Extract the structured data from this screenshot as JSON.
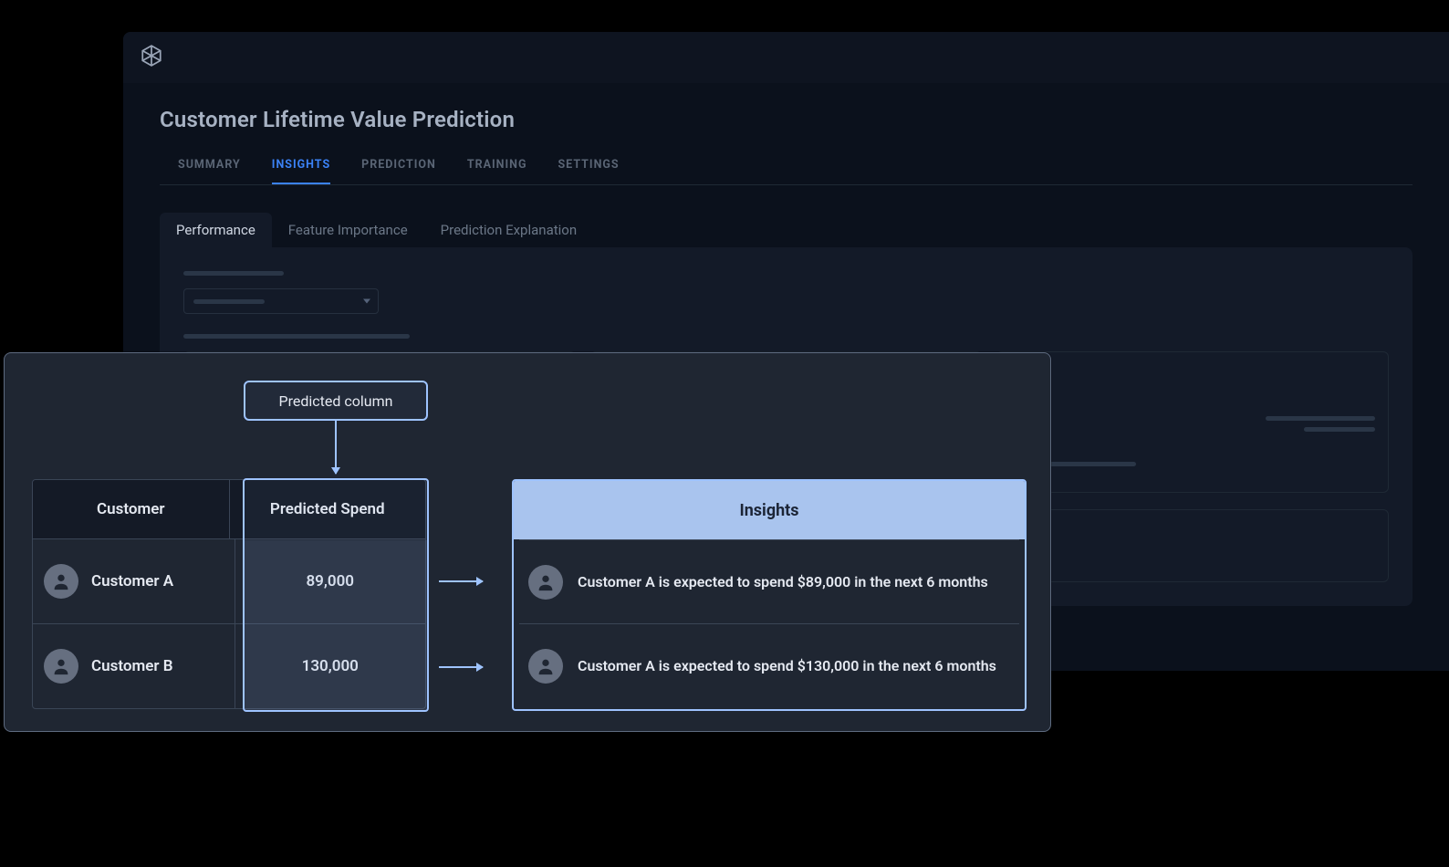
{
  "page_title": "Customer Lifetime Value Prediction",
  "primary_tabs": {
    "items": [
      "SUMMARY",
      "INSIGHTS",
      "PREDICTION",
      "TRAINING",
      "SETTINGS"
    ],
    "active_index": 1
  },
  "sub_tabs": {
    "items": [
      "Performance",
      "Feature Importance",
      "Prediction Explanation"
    ],
    "active_index": 0
  },
  "overlay": {
    "predicted_column_label": "Predicted column",
    "table": {
      "headers": [
        "Customer",
        "Predicted Spend"
      ],
      "rows": [
        {
          "name": "Customer A",
          "value": "89,000"
        },
        {
          "name": "Customer B",
          "value": "130,000"
        }
      ]
    },
    "insights": {
      "title": "Insights",
      "rows": [
        "Customer A is expected to spend $89,000 in the next 6 months",
        "Customer A is expected to spend $130,000 in the next 6 months"
      ]
    }
  },
  "colors": {
    "accent": "#9ec3ff",
    "accent_fill": "#a9c4ee",
    "tab_active": "#3b82f6"
  }
}
